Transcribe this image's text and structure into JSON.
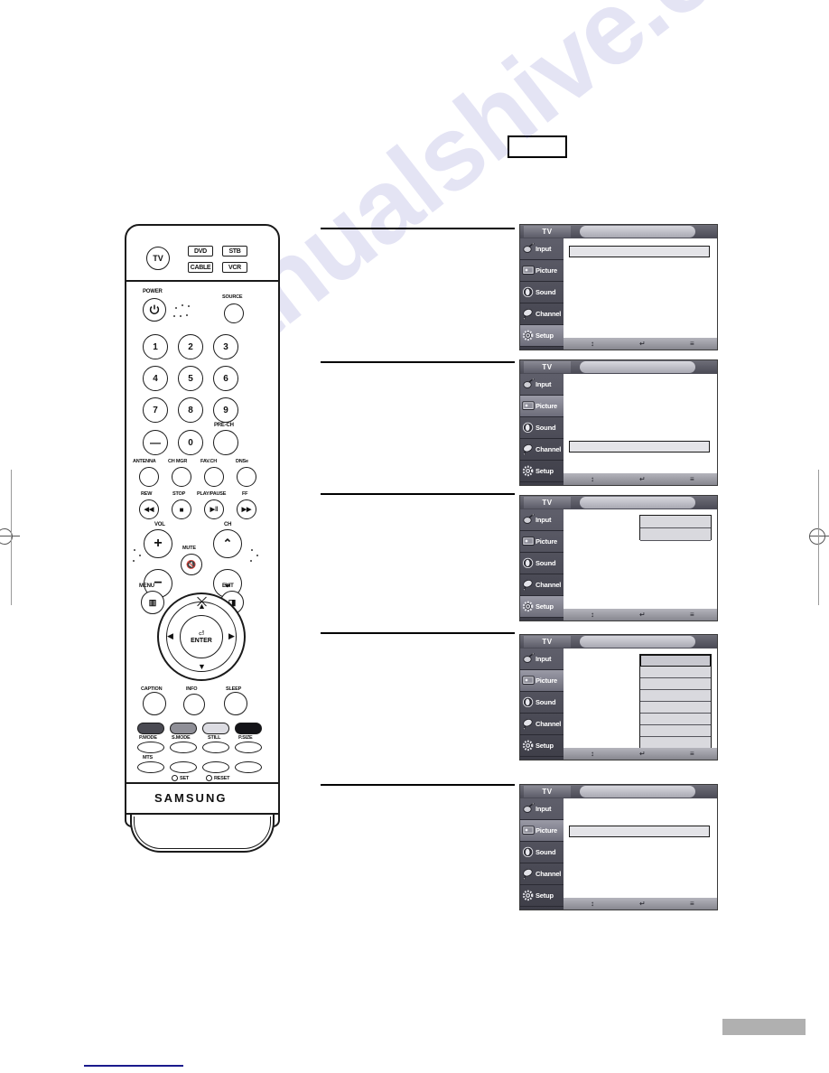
{
  "page": {
    "brand": "SAMSUNG",
    "watermark_text": "manualshive.com"
  },
  "remote": {
    "device_buttons": [
      {
        "name": "TV",
        "label": "TV"
      },
      {
        "name": "DVD",
        "label": "DVD"
      },
      {
        "name": "STB",
        "label": "STB"
      },
      {
        "name": "CABLE",
        "label": "CABLE"
      },
      {
        "name": "VCR",
        "label": "VCR"
      }
    ],
    "power_label": "POWER",
    "source_label": "SOURCE",
    "numbers": [
      "1",
      "2",
      "3",
      "4",
      "5",
      "6",
      "7",
      "8",
      "9",
      "0"
    ],
    "minus_label": "—",
    "pre_ch_label": "PRE-CH",
    "function_row": [
      {
        "label": "ANTENNA"
      },
      {
        "label": "CH MGR"
      },
      {
        "label": "FAV.CH"
      },
      {
        "label": "DNSe"
      }
    ],
    "media_row": [
      {
        "label": "REW",
        "glyph": "◀◀"
      },
      {
        "label": "STOP",
        "glyph": "■"
      },
      {
        "label": "PLAY/PAUSE",
        "glyph": "▶‖"
      },
      {
        "label": "FF",
        "glyph": "▶▶"
      }
    ],
    "vol_label": "VOL",
    "ch_label": "CH",
    "mute_label": "MUTE",
    "menu_label": "MENU",
    "exit_label": "EXIT",
    "enter_label": "ENTER",
    "bottom_row": [
      {
        "label": "CAPTION"
      },
      {
        "label": "INFO"
      },
      {
        "label": "SLEEP"
      }
    ],
    "color_buttons": [
      {
        "label": "P.MODE",
        "color": "#4a4a52"
      },
      {
        "label": "S.MODE",
        "color": "#8f8f97"
      },
      {
        "label": "STILL",
        "color": "#dcdce2"
      },
      {
        "label": "P.SIZE",
        "color": "#141418"
      }
    ],
    "mts_label": "MTS",
    "set_label": "SET",
    "reset_label": "RESET"
  },
  "osd_common": {
    "tv_tab": "TV",
    "menu_items": [
      {
        "label": "Input",
        "icon": "input-jack-icon"
      },
      {
        "label": "Picture",
        "icon": "monitor-icon"
      },
      {
        "label": "Sound",
        "icon": "speaker-icon"
      },
      {
        "label": "Channel",
        "icon": "satellite-dish-icon"
      },
      {
        "label": "Setup",
        "icon": "gear-icon"
      }
    ],
    "footer_icons": [
      {
        "name": "move-updown-icon",
        "glyph": "↕"
      },
      {
        "name": "enter-icon",
        "glyph": "↵"
      },
      {
        "name": "return-menu-icon",
        "glyph": "≡"
      }
    ]
  },
  "osd_panels": [
    {
      "id": "panel-1",
      "active_index": 4,
      "highlight": {
        "type": "field",
        "row": 0
      }
    },
    {
      "id": "panel-2",
      "active_index": 1,
      "highlight": {
        "type": "field",
        "row": 3
      }
    },
    {
      "id": "panel-3",
      "active_index": 4,
      "highlight": {
        "type": "list",
        "rows": 2
      }
    },
    {
      "id": "panel-4",
      "active_index": 1,
      "highlight": {
        "type": "list",
        "rows": 8
      }
    },
    {
      "id": "panel-5",
      "active_index": 1,
      "highlight": {
        "type": "field",
        "row": 1
      }
    }
  ]
}
